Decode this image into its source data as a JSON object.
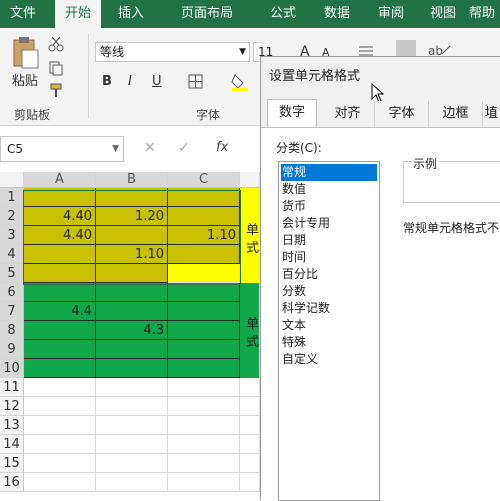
{
  "ribbon_tabs": [
    "文件",
    "开始",
    "插入",
    "页面布局",
    "公式",
    "数据",
    "审阅",
    "视图",
    "帮助"
  ],
  "active_tab": "开始",
  "ribbon": {
    "paste_label": "粘贴",
    "clipboard_group": "剪贴板",
    "font_name": "等线",
    "font_size": "11",
    "bold": "B",
    "italic": "I",
    "underline": "U",
    "font_group": "字体",
    "grow_font": "A",
    "shrink_font": "A"
  },
  "formula_bar": {
    "name_box": "C5",
    "fx": "fx"
  },
  "sheet": {
    "columns": [
      "A",
      "B",
      "C"
    ],
    "rows": [
      "1",
      "2",
      "3",
      "4",
      "5",
      "6",
      "7",
      "8",
      "9",
      "10",
      "11",
      "12",
      "13",
      "14",
      "15",
      "16"
    ],
    "cells": {
      "A2": "4.40",
      "B2": "1.20",
      "A3": "4.40",
      "C3": "1.10",
      "B4": "1.10",
      "A7": "4.4",
      "B8": "4.3"
    },
    "d_col_text_top": "单\n式",
    "d_col_text_bottom": "单\n式"
  },
  "dialog": {
    "title": "设置单元格格式",
    "tabs": [
      "数字",
      "对齐",
      "字体",
      "边框",
      "埴"
    ],
    "active_tab": "数字",
    "category_label": "分类(C):",
    "categories": [
      "常规",
      "数值",
      "货币",
      "会计专用",
      "日期",
      "时间",
      "百分比",
      "分数",
      "科学记数",
      "文本",
      "特殊",
      "自定义"
    ],
    "selected_category": "常规",
    "sample_label": "示例",
    "description": "常规单元格格式不"
  },
  "colors": {
    "excel_green": "#217346",
    "cell_olive": "#c8c000",
    "cell_yellow": "#ffff00",
    "cell_green": "#10a84a",
    "selection_blue": "#0078d7"
  }
}
